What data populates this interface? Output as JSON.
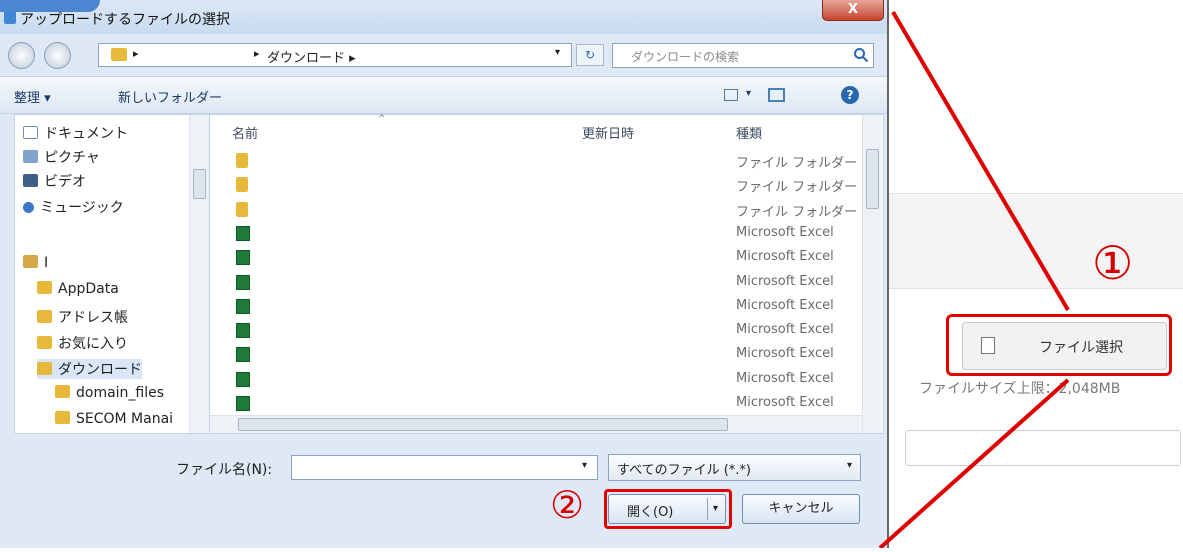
{
  "dialog": {
    "title": "アップロードするファイルの選択",
    "close_label": "X",
    "address": {
      "arrow": "▸",
      "separator": "▸",
      "path": "ダウンロード ▸",
      "dropdown": "▾"
    },
    "refresh_label": "↻",
    "search_placeholder": "ダウンロードの検索",
    "toolbar": {
      "organize": "整理 ▾",
      "new_folder": "新しいフォルダー",
      "view_dropdown": "▾",
      "help": "?"
    },
    "nav_items": [
      {
        "label": "ドキュメント",
        "icon": "documents-icon"
      },
      {
        "label": "ピクチャ",
        "icon": "pictures-icon"
      },
      {
        "label": "ビデオ",
        "icon": "videos-icon"
      },
      {
        "label": "ミュージック",
        "icon": "music-icon"
      },
      {
        "label": "I",
        "icon": "user-folder-icon"
      },
      {
        "label": "AppData",
        "icon": "folder-icon"
      },
      {
        "label": "アドレス帳",
        "icon": "contacts-icon"
      },
      {
        "label": "お気に入り",
        "icon": "favorites-icon"
      },
      {
        "label": "ダウンロード",
        "icon": "downloads-icon"
      },
      {
        "label": "domain_files",
        "icon": "folder-icon"
      },
      {
        "label": "SECOM Manai",
        "icon": "folder-icon"
      }
    ],
    "columns": {
      "name": "名前",
      "modified": "更新日時",
      "type": "種類",
      "sort_indicator": "^"
    },
    "rows": [
      {
        "kind": "folder",
        "type": "ファイル フォルダー"
      },
      {
        "kind": "folder",
        "type": "ファイル フォルダー"
      },
      {
        "kind": "folder",
        "type": "ファイル フォルダー"
      },
      {
        "kind": "excel",
        "type": "Microsoft Excel"
      },
      {
        "kind": "excel",
        "type": "Microsoft Excel"
      },
      {
        "kind": "excel",
        "type": "Microsoft Excel"
      },
      {
        "kind": "excel",
        "type": "Microsoft Excel"
      },
      {
        "kind": "excel",
        "type": "Microsoft Excel"
      },
      {
        "kind": "excel",
        "type": "Microsoft Excel"
      },
      {
        "kind": "excel",
        "type": "Microsoft Excel"
      },
      {
        "kind": "excel",
        "type": "Microsoft Excel"
      }
    ],
    "filename_label": "ファイル名(N):",
    "filename_value": "",
    "filter_value": "すべてのファイル (*.*)",
    "filter_dropdown": "▾",
    "open_label": "開く(O)",
    "open_dropdown": "▾",
    "cancel_label": "キャンセル"
  },
  "webpage": {
    "file_select_label": "ファイル選択",
    "size_limit": "ファイルサイズ上限：2,048MB"
  },
  "annotations": {
    "mark1": "①",
    "mark2": "②",
    "color": "#e00000"
  }
}
